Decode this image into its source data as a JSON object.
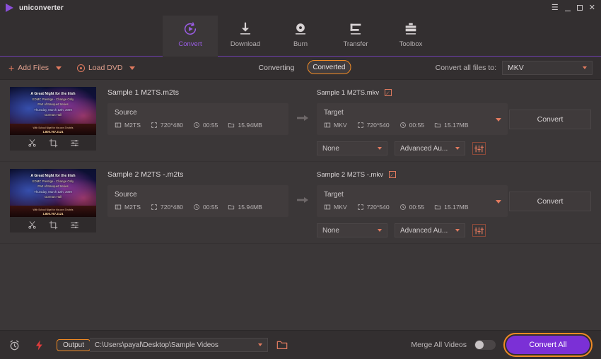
{
  "window": {
    "app_title": "uniconverter",
    "controls": {
      "menu": "☰",
      "minimize": "–",
      "maximize": "□",
      "close": "✕"
    }
  },
  "nav": {
    "items": [
      {
        "label": "Convert",
        "icon": "convert-icon",
        "active": true
      },
      {
        "label": "Download",
        "icon": "download-icon",
        "active": false
      },
      {
        "label": "Burn",
        "icon": "burn-icon",
        "active": false
      },
      {
        "label": "Transfer",
        "icon": "transfer-icon",
        "active": false
      },
      {
        "label": "Toolbox",
        "icon": "toolbox-icon",
        "active": false
      }
    ]
  },
  "toolbar": {
    "add_files_label": "Add Files",
    "load_dvd_label": "Load DVD",
    "tabs": [
      {
        "label": "Converting",
        "selected": false
      },
      {
        "label": "Converted",
        "selected": true
      }
    ],
    "convert_all_to_label": "Convert all files to:",
    "convert_all_to_value": "MKV"
  },
  "files": [
    {
      "source_name": "Sample 1 M2TS.m2ts",
      "thumbnail": {
        "title": "A Great Night for the Irish",
        "line2": "EDMC Prestige - Change Only",
        "line3": "Part of Banquet Series",
        "line4": "Thursday, March 12th, 2009",
        "line5": "Gorman Hall",
        "band1": "With School Nigel for his own 3 hotels",
        "band2": "1.800.767.2121"
      },
      "tools": [
        "trim-icon",
        "crop-icon",
        "effect-icon"
      ],
      "source": {
        "title": "Source",
        "format": "M2TS",
        "resolution": "720*480",
        "duration": "00:55",
        "size": "15.94MB"
      },
      "target_name": "Sample 1 M2TS.mkv",
      "target": {
        "title": "Target",
        "format": "MKV",
        "resolution": "720*540",
        "duration": "00:55",
        "size": "15.17MB"
      },
      "subtitle_option": "None",
      "audio_option": "Advanced Au...",
      "convert_label": "Convert"
    },
    {
      "source_name": "Sample 2 M2TS -.m2ts",
      "thumbnail": {
        "title": "A Great Night for the Irish",
        "line2": "EDMC Prestige - Change Only",
        "line3": "Part of Banquet Series",
        "line4": "Thursday, March 12th, 2009",
        "line5": "Gorman Hall",
        "band1": "With School Nigel for his own 3 hotels",
        "band2": "1.800.767.2121"
      },
      "tools": [
        "trim-icon",
        "crop-icon",
        "effect-icon"
      ],
      "source": {
        "title": "Source",
        "format": "M2TS",
        "resolution": "720*480",
        "duration": "00:55",
        "size": "15.94MB"
      },
      "target_name": "Sample 2 M2TS -.mkv",
      "target": {
        "title": "Target",
        "format": "MKV",
        "resolution": "720*540",
        "duration": "00:55",
        "size": "15.17MB"
      },
      "subtitle_option": "None",
      "audio_option": "Advanced Au...",
      "convert_label": "Convert"
    }
  ],
  "bottom": {
    "output_label": "Output",
    "output_path": "C:\\Users\\payal\\Desktop\\Sample Videos",
    "merge_label": "Merge All Videos",
    "merge_on": false,
    "convert_all_label": "Convert All"
  },
  "colors": {
    "accent_purple": "#7b30d6",
    "accent_orange": "#f08a24",
    "accent_salmon": "#e07a5f",
    "bg": "#3b3738",
    "panel_bg": "#413c3d",
    "chrome": "#332f30"
  }
}
